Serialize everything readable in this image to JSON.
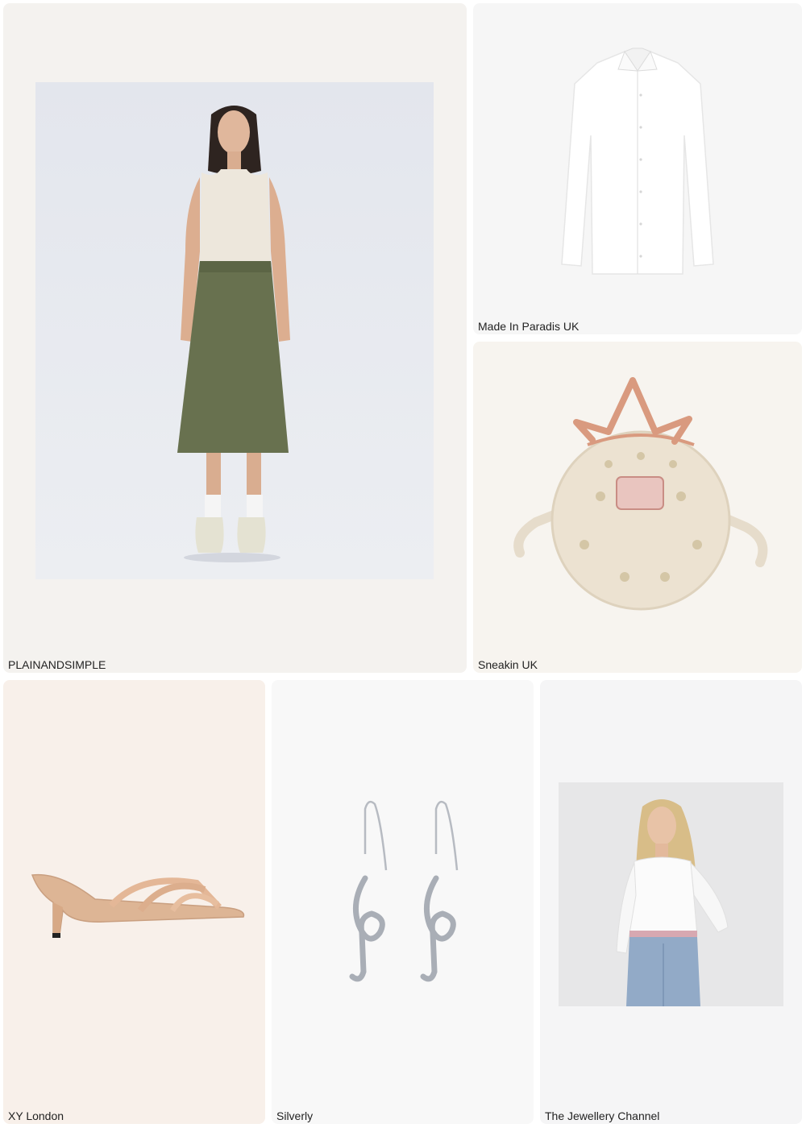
{
  "colors": {
    "card_warm_gray": "#f4f2ef",
    "card_light_gray": "#f6f6f6",
    "card_cream": "#f7f4ef",
    "card_blush": "#f8f0ea",
    "card_silver": "#f8f8f8",
    "card_cool": "#f5f5f6",
    "label_text": "#222222"
  },
  "products": [
    {
      "brand": "PLAINANDSIMPLE",
      "item_icon": "midi-skirt-outfit-icon"
    },
    {
      "brand": "Made In Paradis UK",
      "item_icon": "white-shirt-icon"
    },
    {
      "brand": "Sneakin UK",
      "item_icon": "crown-round-bag-icon"
    },
    {
      "brand": "XY London",
      "item_icon": "strappy-mule-icon"
    },
    {
      "brand": "Silverly",
      "item_icon": "treble-clef-earrings-icon"
    },
    {
      "brand": "The Jewellery Channel",
      "item_icon": "white-bodysuit-model-icon"
    }
  ]
}
